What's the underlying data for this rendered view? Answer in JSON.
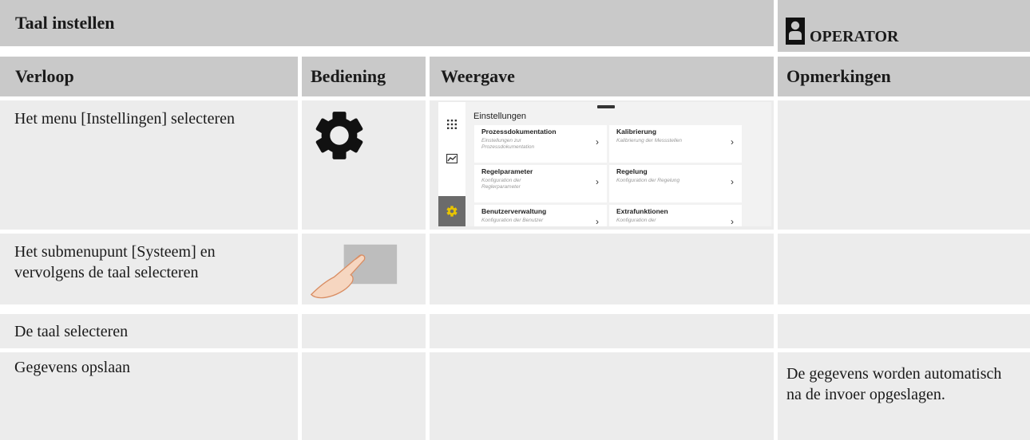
{
  "header": {
    "title": "Taal instellen",
    "role": "OPERATOR"
  },
  "columns": {
    "verloop": "Verloop",
    "bediening": "Bediening",
    "weergave": "Weergave",
    "opmerkingen": "Opmerkingen"
  },
  "rows": [
    {
      "verloop": "Het menu [Instellingen] selecteren",
      "bediening_icon": "gear-icon",
      "opmerkingen": ""
    },
    {
      "verloop": "Het submenupunt [Systeem] en vervolgens de taal selecteren",
      "bediening_icon": "finger-tap-icon",
      "opmerkingen": ""
    },
    {
      "verloop": "De taal selecteren",
      "opmerkingen": ""
    },
    {
      "verloop": "Gegevens opslaan",
      "opmerkingen": "De gegevens worden automatisch na de invoer opgeslagen."
    }
  ],
  "screen": {
    "title": "Einstellungen",
    "tiles": [
      {
        "title": "Prozessdokumentation",
        "subtitle": "Einstellungen zur Prozessdokumentation"
      },
      {
        "title": "Kalibrierung",
        "subtitle": "Kalibrierung der Messstellen"
      },
      {
        "title": "Regelparameter",
        "subtitle": "Konfiguration der Reglerparameter"
      },
      {
        "title": "Regelung",
        "subtitle": "Konfiguration der Regelung"
      },
      {
        "title": "Benutzerverwaltung",
        "subtitle": "Konfiguration der Benutzer"
      },
      {
        "title": "Extrafunktionen",
        "subtitle": "Konfiguration der"
      }
    ],
    "accent_color": "#e8c400"
  }
}
